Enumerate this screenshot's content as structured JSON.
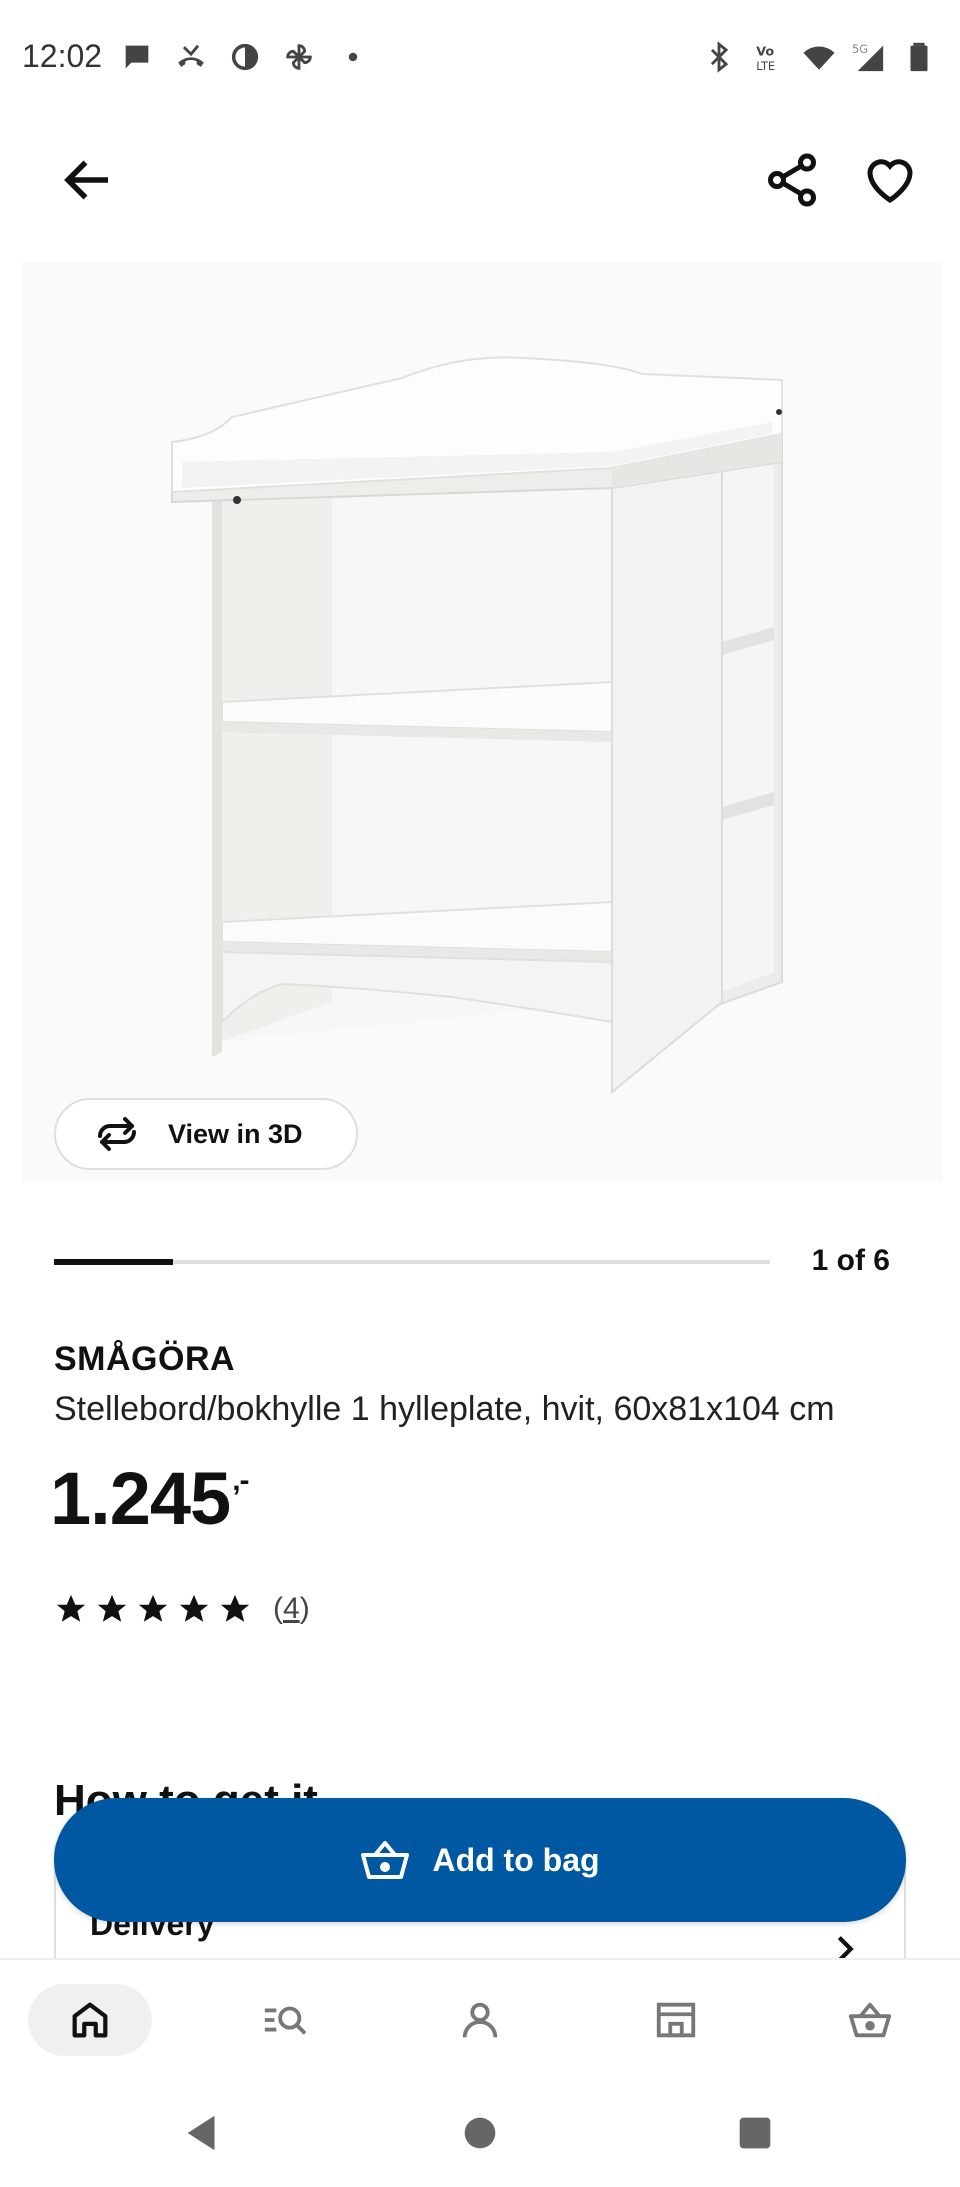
{
  "status_bar": {
    "time": "12:02",
    "left_icons": [
      "chat-bubble-icon",
      "missed-call-icon",
      "contrast-icon",
      "pinwheel-icon",
      "dot-icon"
    ],
    "right_icons": [
      "bluetooth-icon",
      "volte-icon",
      "wifi-icon",
      "5g-signal-icon",
      "battery-icon"
    ]
  },
  "app_bar": {
    "back_icon": "arrow-left-icon",
    "share_icon": "share-icon",
    "favourite_icon": "heart-icon"
  },
  "gallery": {
    "image_subject": "white changing table / bookshelf",
    "view_3d_label": "View in 3D",
    "counter": "1 of 6",
    "current": 1,
    "total": 6
  },
  "product": {
    "name": "SMÅGÖRA",
    "description": "Stellebord/bokhylle 1 hylleplate, hvit, 60x81x104 cm",
    "price": "1.245",
    "price_suffix": ",-",
    "rating_stars": 5,
    "review_count_open": "(",
    "review_count": "4",
    "review_count_close": ")"
  },
  "how_to_get": {
    "heading": "How to get it",
    "delivery_label": "Delivery"
  },
  "cta": {
    "add_to_bag_label": "Add to bag"
  },
  "bottom_nav": {
    "items": [
      "home-icon",
      "search-list-icon",
      "profile-icon",
      "store-icon",
      "bag-icon"
    ],
    "active": "home-icon"
  },
  "colors": {
    "brand_blue": "#0058a3",
    "text": "#111111",
    "divider": "#dfdfdf"
  }
}
